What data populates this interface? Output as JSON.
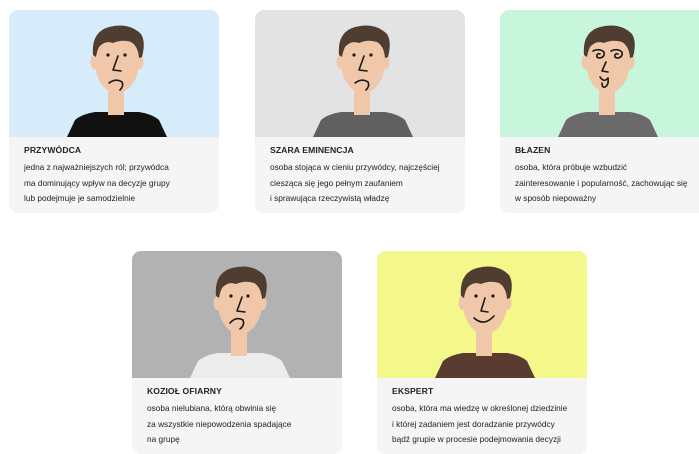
{
  "cards": [
    {
      "title": "PRZYWÓDCA",
      "lines": [
        "jedna z najważniejszych ról; przywódca",
        "ma dominujący wpływ na decyzje grupy",
        "lub podejmuje je samodzielnie"
      ],
      "bg_color": "#d6ecfb",
      "shirt_color": "#111111",
      "expression": "neutral"
    },
    {
      "title": "SZARA EMINENCJA",
      "lines": [
        "osoba stojąca w cieniu przywódcy, najczęściej",
        "ciesząca się jego pełnym zaufaniem",
        "i sprawująca rzeczywistą władzę"
      ],
      "bg_color": "#e3e3e3",
      "shirt_color": "#606060",
      "expression": "neutral"
    },
    {
      "title": "BŁAZEN",
      "lines": [
        "osoba, która próbuje wzbudzić",
        "zainteresowanie i popularność, zachowując się",
        "w sposób niepoważny"
      ],
      "bg_color": "#c8f6dd",
      "shirt_color": "#6a6a6a",
      "expression": "silly"
    },
    {
      "title": "KOZIOŁ OFIARNY",
      "lines": [
        "osoba nielubiana, którą obwinia się",
        "za wszystkie niepowodzenia spadające",
        "na grupę"
      ],
      "bg_color": "#b2b2b2",
      "shirt_color": "#ececec",
      "expression": "sad"
    },
    {
      "title": "EKSPERT",
      "lines": [
        "osoba, która ma wiedzę w określonej dziedzinie",
        "i której zadaniem jest doradzanie przywódcy",
        "bądź grupie w procesie podejmowania decyzji"
      ],
      "bg_color": "#f4f78a",
      "shirt_color": "#5a3b30",
      "expression": "smile"
    }
  ],
  "colors": {
    "skin": "#f0c7a8",
    "hair": "#4f3d31",
    "line": "#1a1a1a"
  }
}
